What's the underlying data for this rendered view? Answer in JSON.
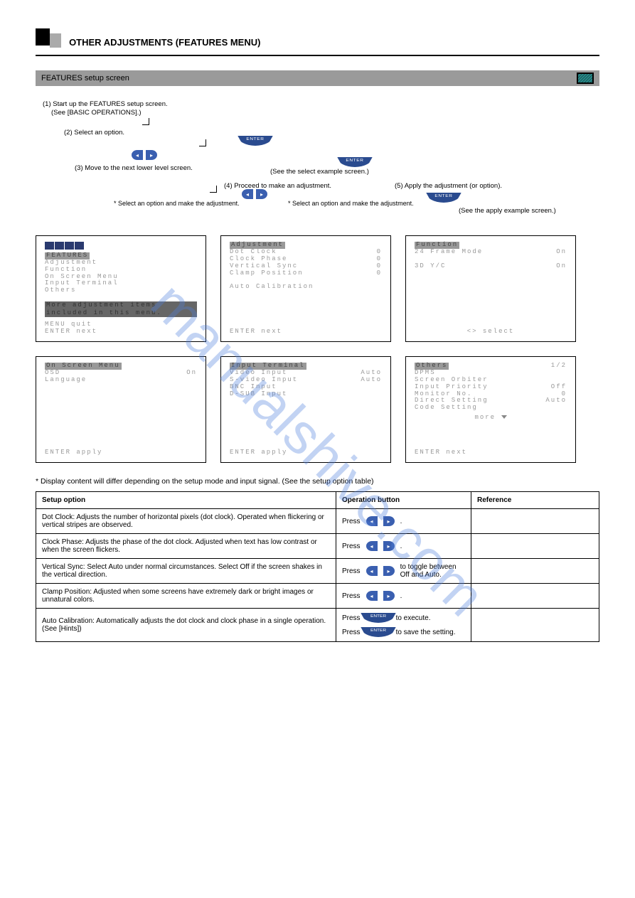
{
  "watermark": "manualshive.com",
  "heading": "OTHER ADJUSTMENTS (FEATURES MENU)",
  "strip_title": "FEATURES setup screen",
  "flow": {
    "step1": "(1) Start up the FEATURES setup screen.",
    "step1a": "(See [BASIC OPERATIONS].)",
    "step2": "(2) Select an option.",
    "step3": "(3) Move to the next lower level screen.",
    "note1": "* Select an option and make the adjustment.",
    "note2": "* Select an option and make the adjustment.",
    "step4": "(4) Proceed to make an adjustment.",
    "step5": "(5) Apply the adjustment (or option).",
    "see1": "(See the select example screen.)",
    "see2": "(See the apply example screen.)"
  },
  "menus": {
    "features": {
      "title": "FEATURES",
      "items": [
        "Adjustment",
        "Function",
        "On Screen Menu",
        "Input Terminal",
        "Others"
      ],
      "box": "More adjustment items included in this menu.",
      "foot": [
        "MENU quit",
        "ENTER next"
      ]
    },
    "adjustment": {
      "title": "Adjustment",
      "items": [
        {
          "l": "Dot Clock",
          "r": "0"
        },
        {
          "l": "Clock Phase",
          "r": "0"
        },
        {
          "l": "Vertical Sync",
          "r": "0"
        },
        {
          "l": "Clamp Position",
          "r": "0"
        }
      ],
      "extra": "Auto Calibration",
      "foot": "ENTER next"
    },
    "function": {
      "title": "Function",
      "items": [
        {
          "l": "24 Frame Mode",
          "r": "On"
        },
        {
          "l": "3D Y/C",
          "r": "On"
        }
      ],
      "foot": "<> select"
    },
    "osm": {
      "title": "On Screen Menu",
      "items": [
        {
          "l": "OSD",
          "r": "On"
        },
        {
          "l": "Language",
          "r": ""
        }
      ],
      "foot": "ENTER apply"
    },
    "input": {
      "title": "Input Terminal",
      "items": [
        {
          "l": "Video Input",
          "r": "Auto"
        },
        {
          "l": "S-video Input",
          "r": "Auto"
        },
        {
          "l": "BNC Input",
          "r": ""
        },
        {
          "l": "D-SUB Input",
          "r": ""
        }
      ],
      "foot": "ENTER apply"
    },
    "others": {
      "title": "Others",
      "page": "1/2",
      "items": [
        {
          "l": "DPMS",
          "r": ""
        },
        {
          "l": "Screen Orbiter",
          "r": ""
        },
        {
          "l": "Input Priority",
          "r": "Off"
        },
        {
          "l": "Monitor No.",
          "r": "0"
        },
        {
          "l": "Direct Setting",
          "r": "Auto"
        },
        {
          "l": "Code Setting",
          "r": ""
        }
      ],
      "more": "more",
      "foot": "ENTER next"
    }
  },
  "tbl_intro": "* Display content will differ depending on the setup mode and input signal. (See the setup option table)",
  "table": {
    "headers": [
      "Setup option",
      "Operation button",
      "Reference"
    ],
    "rows": [
      {
        "opt": "Dot Clock: Adjusts the number of horizontal pixels (dot clock). Operated when flickering or vertical stripes are observed.",
        "op": "Press     .",
        "ref": " "
      },
      {
        "opt": "Clock Phase: Adjusts the phase of the dot clock. Adjusted when text has low contrast or when the screen flickers.",
        "op": "Press     .",
        "ref": " "
      },
      {
        "opt": "Vertical Sync: Select Auto under normal circumstances. Select Off if the screen shakes in the vertical direction.",
        "op": "Press    to toggle between Off and Auto.",
        "ref": " "
      },
      {
        "opt": "Clamp Position: Adjusted when some screens have extremely dark or bright images or unnatural colors.",
        "op": "Press     .",
        "ref": " "
      },
      {
        "opt": "Auto Calibration: Automatically adjusts the dot clock and clock phase in a single operation. (See [Hints])",
        "op": [
          "Press   to execute.",
          "Press   to save the setting."
        ],
        "ref": " "
      }
    ]
  }
}
